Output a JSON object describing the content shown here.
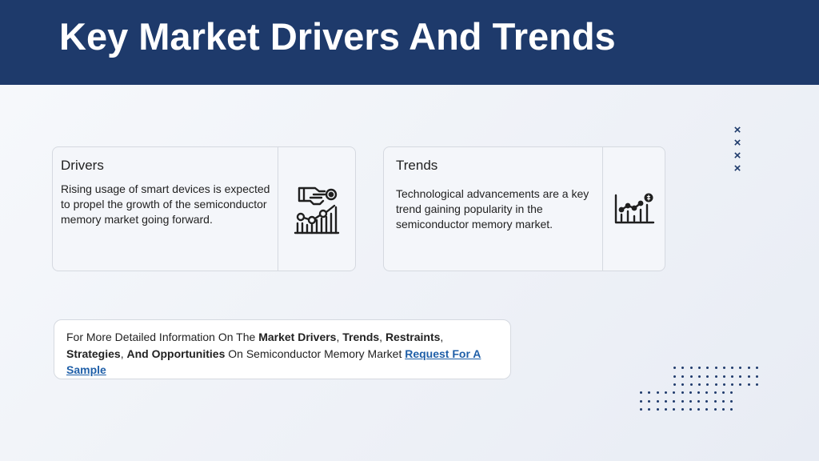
{
  "header": {
    "title": "Key Market Drivers And Trends"
  },
  "drivers": {
    "title": "Drivers",
    "body": "Rising usage of smart devices is expected to propel the growth of the semiconductor memory market going forward.",
    "icon": "hand-network-icon"
  },
  "trends": {
    "title": "Trends",
    "body": "Technological advancements are a key trend gaining popularity in the semiconductor memory market.",
    "icon": "growth-chart-icon"
  },
  "info": {
    "prefix": "For More Detailed Information On The ",
    "b1": "Market Drivers",
    "sep1": ", ",
    "b2": "Trends",
    "sep2": ", ",
    "b3": "Restraints",
    "sep3": ", ",
    "b4": "Strategies",
    "sep4": ", ",
    "b5": "And Opportunities",
    "suffix": " On Semiconductor Memory Market  ",
    "link": "Request For A Sample"
  },
  "decor": {
    "accent": "#1e3a6b",
    "mark": "×"
  }
}
